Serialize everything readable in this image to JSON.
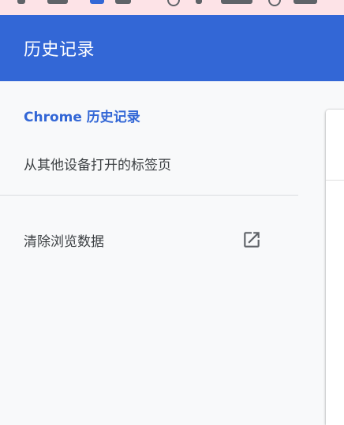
{
  "header": {
    "title": "历史记录"
  },
  "nav": {
    "items": [
      {
        "label": "Chrome 历史记录",
        "active": true
      },
      {
        "label": "从其他设备打开的标签页",
        "active": false
      }
    ],
    "clear_browsing_data": {
      "label": "清除浏览数据",
      "icon": "external-link-icon"
    }
  },
  "colors": {
    "header_bg": "#3367d6",
    "active_nav": "#3367d6",
    "text": "#3c4043",
    "sidebar_bg": "#f8f9fa",
    "tabstrip_bg": "#fde3e7"
  }
}
